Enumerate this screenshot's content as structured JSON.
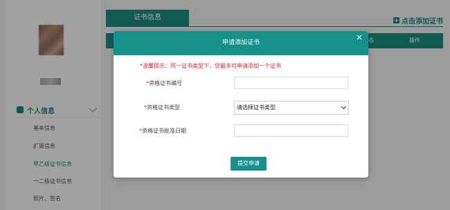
{
  "background": {
    "tab_title": "证书信息",
    "add_certificate": "点击添加证书",
    "table_headers": [
      "态",
      "操作"
    ],
    "sidebar": {
      "section_title": "个人信息",
      "items": [
        {
          "label": "基本信息",
          "active": false
        },
        {
          "label": "扩展信息",
          "active": false
        },
        {
          "label": "甲乙级证书信息",
          "active": true
        },
        {
          "label": "一二级证书信息",
          "active": false
        },
        {
          "label": "照片、签名",
          "active": false
        }
      ]
    }
  },
  "modal": {
    "title": "申请添加证书",
    "close_symbol": "×",
    "notice": "*温馨提示：同一证书类型下，您最多可申请添加一个证书",
    "fields": [
      {
        "required_mark": "*",
        "label": "资格证书编号",
        "value": ""
      },
      {
        "required_mark": "*",
        "label": "资格证书类型",
        "selected": "请选择证书类型"
      },
      {
        "required_mark": "*",
        "label": "资格证书批准日期",
        "value": ""
      }
    ],
    "submit_label": "提交申请"
  },
  "colors": {
    "primary": "#16918a",
    "required": "#d7262b",
    "overlay": "rgba(0,0,0,0.35)"
  }
}
